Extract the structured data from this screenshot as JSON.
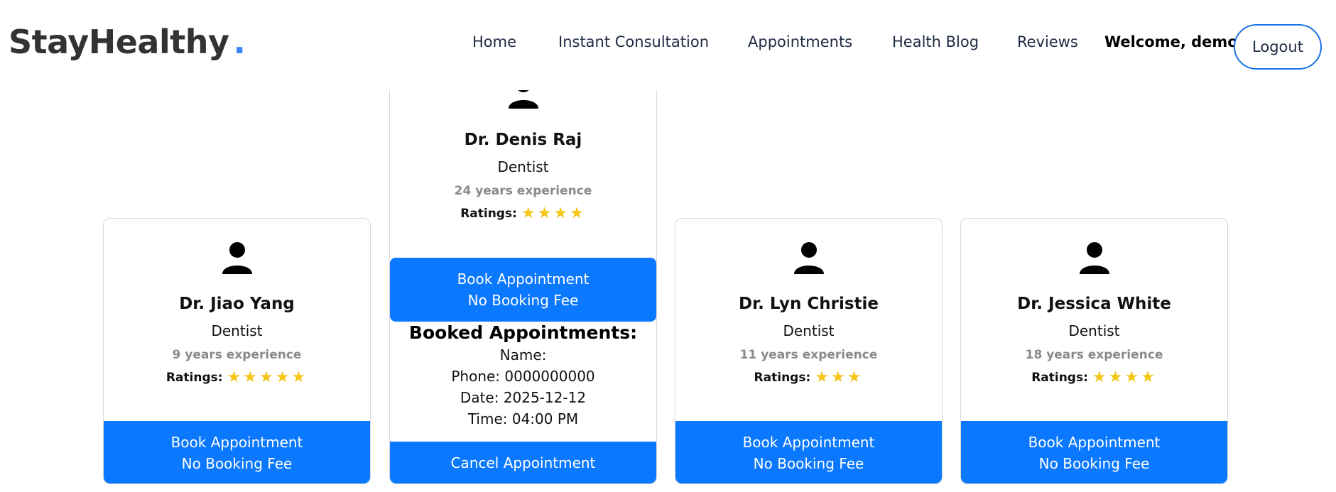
{
  "brand": {
    "name": "StayHealthy",
    "dot": "."
  },
  "nav": {
    "items": [
      "Home",
      "Instant Consultation",
      "Appointments",
      "Health Blog",
      "Reviews"
    ],
    "welcome": "Welcome, demo",
    "logout": "Logout"
  },
  "colors": {
    "accent": "#0a78ff",
    "star": "#f5c518",
    "brand_dot": "#3b82f6"
  },
  "doctors": [
    {
      "name": "Dr. Jiao Yang",
      "speciality": "Dentist",
      "experience": "9 years experience",
      "ratings_label": "Ratings:",
      "stars": "★★★★★",
      "rating": 5,
      "book_line1": "Book Appointment",
      "book_line2": "No Booking Fee"
    },
    {
      "name": "Dr. Denis Raj",
      "speciality": "Dentist",
      "experience": "24 years experience",
      "ratings_label": "Ratings:",
      "stars": "★★★★",
      "rating": 4,
      "book_line1": "Book Appointment",
      "book_line2": "No Booking Fee",
      "booked": {
        "title": "Booked Appointments:",
        "name": "Name:",
        "phone": "Phone: 0000000000",
        "date": "Date: 2025-12-12",
        "time": "Time: 04:00 PM",
        "cancel": "Cancel Appointment"
      }
    },
    {
      "name": "Dr. Lyn Christie",
      "speciality": "Dentist",
      "experience": "11 years experience",
      "ratings_label": "Ratings:",
      "stars": "★★★",
      "rating": 3,
      "book_line1": "Book Appointment",
      "book_line2": "No Booking Fee"
    },
    {
      "name": "Dr. Jessica White",
      "speciality": "Dentist",
      "experience": "18 years experience",
      "ratings_label": "Ratings:",
      "stars": "★★★★",
      "rating": 4,
      "book_line1": "Book Appointment",
      "book_line2": "No Booking Fee"
    }
  ]
}
